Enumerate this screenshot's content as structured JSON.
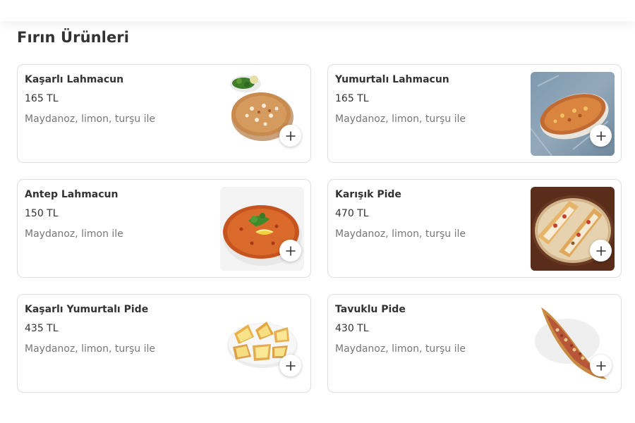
{
  "section": {
    "title": "Fırın Ürünleri"
  },
  "colors": {
    "card_border": "#dedede",
    "text": "#333333",
    "muted": "#777777"
  },
  "products": [
    {
      "name": "Kaşarlı Lahmacun",
      "price": "165 TL",
      "description": "Maydanoz, limon, turşu ile",
      "image_icon": "lahmacun-photo",
      "add_icon": "plus-icon"
    },
    {
      "name": "Yumurtalı Lahmacun",
      "price": "165 TL",
      "description": "Maydanoz, limon, turşu ile",
      "image_icon": "lahmacun-photo",
      "add_icon": "plus-icon"
    },
    {
      "name": "Antep Lahmacun",
      "price": "150 TL",
      "description": "Maydanoz, limon ile",
      "image_icon": "lahmacun-photo",
      "add_icon": "plus-icon"
    },
    {
      "name": "Karışık Pide",
      "price": "470 TL",
      "description": "Maydanoz, limon, turşu ile",
      "image_icon": "pide-photo",
      "add_icon": "plus-icon"
    },
    {
      "name": "Kaşarlı Yumurtalı Pide",
      "price": "435 TL",
      "description": "Maydanoz, limon, turşu ile",
      "image_icon": "pide-photo",
      "add_icon": "plus-icon"
    },
    {
      "name": "Tavuklu Pide",
      "price": "430 TL",
      "description": "Maydanoz, limon, turşu ile",
      "image_icon": "pide-photo",
      "add_icon": "plus-icon"
    }
  ]
}
